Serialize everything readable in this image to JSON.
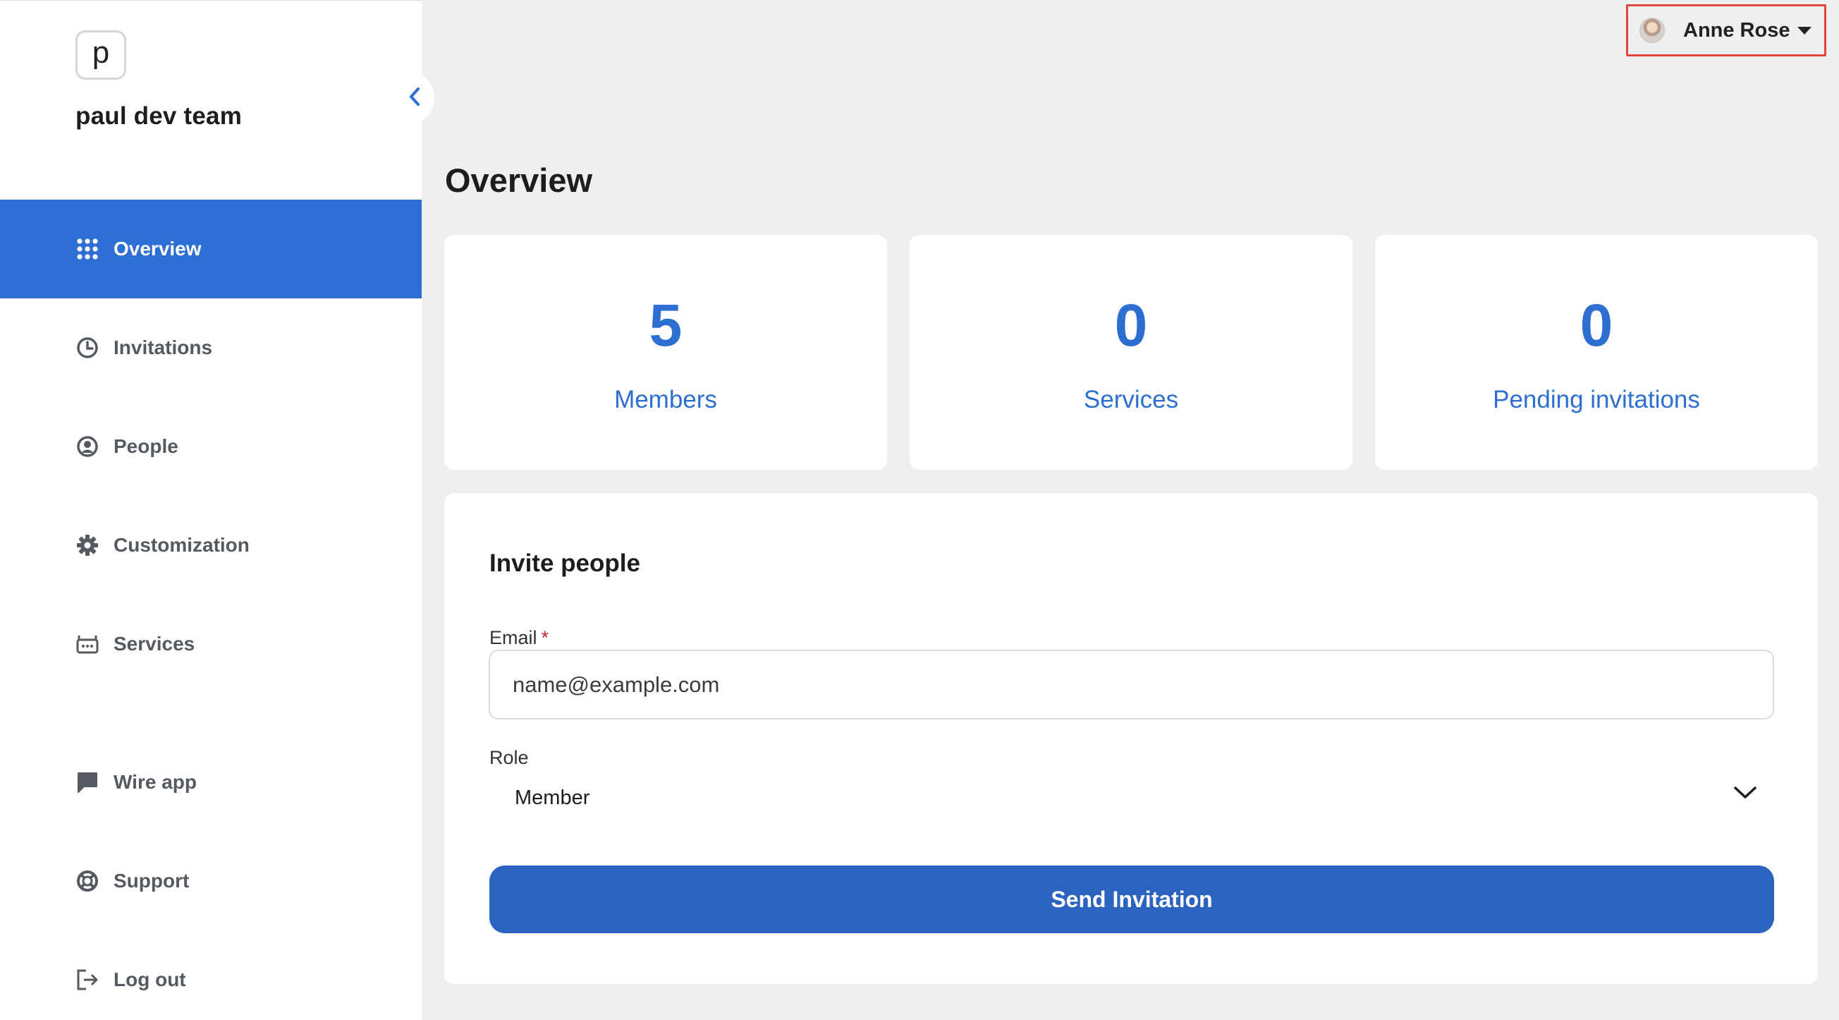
{
  "team": {
    "logo_letter": "p",
    "name": "paul dev team"
  },
  "sidebar": {
    "items": [
      {
        "label": "Overview",
        "icon": "grid-dots-icon",
        "active": true
      },
      {
        "label": "Invitations",
        "icon": "clock-icon"
      },
      {
        "label": "People",
        "icon": "user-circle-icon"
      },
      {
        "label": "Customization",
        "icon": "gear-icon"
      },
      {
        "label": "Services",
        "icon": "robot-icon"
      },
      {
        "label": "Wire app",
        "icon": "chat-bubble-icon"
      },
      {
        "label": "Support",
        "icon": "lifebuoy-icon"
      },
      {
        "label": "Log out",
        "icon": "logout-icon"
      }
    ]
  },
  "header": {
    "user_name": "Anne Rose"
  },
  "main": {
    "title": "Overview",
    "stats": [
      {
        "value": "5",
        "label": "Members"
      },
      {
        "value": "0",
        "label": "Services"
      },
      {
        "value": "0",
        "label": "Pending invitations"
      }
    ],
    "invite": {
      "title": "Invite people",
      "email_label": "Email",
      "required_mark": "*",
      "email_placeholder": "name@example.com",
      "role_label": "Role",
      "role_value": "Member",
      "submit_label": "Send Invitation"
    }
  },
  "colors": {
    "accent": "#2e6fd6",
    "button": "#2c63c0",
    "highlight_border": "#e0463a"
  }
}
